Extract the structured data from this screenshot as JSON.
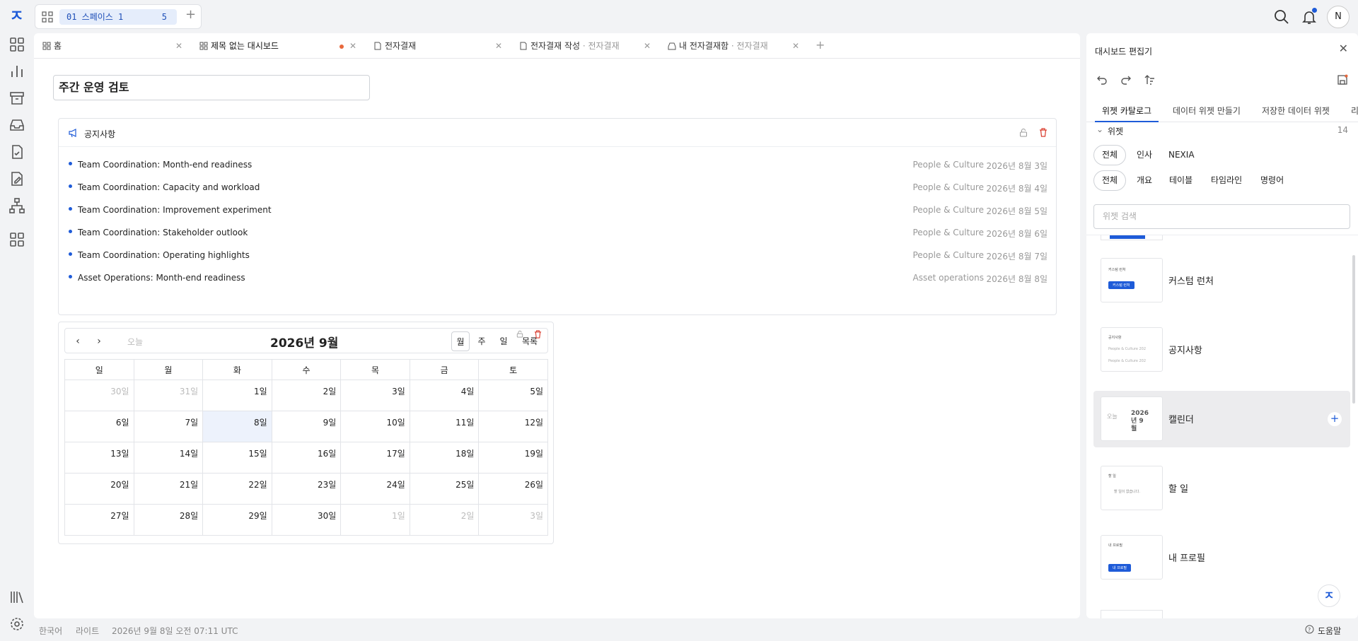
{
  "app": {
    "logo_glyph": "ㅈ",
    "space_label": "01 스페이스 1",
    "space_count": "5",
    "user_initial": "N"
  },
  "tabs": [
    {
      "label": "홈",
      "sub": ""
    },
    {
      "label": "제목 없는 대시보드",
      "sub": ""
    },
    {
      "label": "전자결재",
      "sub": ""
    },
    {
      "label": "전자결재 작성",
      "sub": "· 전자결재"
    },
    {
      "label": "내 전자결재함",
      "sub": "· 전자결재"
    }
  ],
  "dashboard": {
    "title": "주간 운영 검토"
  },
  "notice": {
    "title": "공지사항",
    "items": [
      {
        "text": "Team Coordination: Month-end readiness",
        "category": "People & Culture",
        "date": "2026년 8월 3일"
      },
      {
        "text": "Team Coordination: Capacity and workload",
        "category": "People & Culture",
        "date": "2026년 8월 4일"
      },
      {
        "text": "Team Coordination: Improvement experiment",
        "category": "People & Culture",
        "date": "2026년 8월 5일"
      },
      {
        "text": "Team Coordination: Stakeholder outlook",
        "category": "People & Culture",
        "date": "2026년 8월 6일"
      },
      {
        "text": "Team Coordination: Operating highlights",
        "category": "People & Culture",
        "date": "2026년 8월 7일"
      },
      {
        "text": "Asset Operations: Month-end readiness",
        "category": "Asset operations",
        "date": "2026년 8월 8일"
      }
    ]
  },
  "calendar": {
    "title": "2026년 9월",
    "today_label": "오늘",
    "views": [
      "월",
      "주",
      "일",
      "목록"
    ],
    "weekdays": [
      "일",
      "월",
      "화",
      "수",
      "목",
      "금",
      "토"
    ],
    "weeks": [
      [
        "30일",
        "31일",
        "1일",
        "2일",
        "3일",
        "4일",
        "5일"
      ],
      [
        "6일",
        "7일",
        "8일",
        "9일",
        "10일",
        "11일",
        "12일"
      ],
      [
        "13일",
        "14일",
        "15일",
        "16일",
        "17일",
        "18일",
        "19일"
      ],
      [
        "20일",
        "21일",
        "22일",
        "23일",
        "24일",
        "25일",
        "26일"
      ],
      [
        "27일",
        "28일",
        "29일",
        "30일",
        "1일",
        "2일",
        "3일"
      ]
    ]
  },
  "status": {
    "language": "한국어",
    "theme": "라이트",
    "datetime": "2026년 9월 8일 오전 07:11 UTC",
    "help": "도움말"
  },
  "editor": {
    "title": "대시보드 편집기",
    "tabs": [
      "위젯 카탈로그",
      "데이터 위젯 만들기",
      "저장한 데이터 위젯",
      "리"
    ],
    "section_label": "위젯",
    "section_count": "14",
    "filter1": [
      "전체",
      "인사",
      "NEXIA"
    ],
    "filter2": [
      "전체",
      "개요",
      "테이블",
      "타임라인",
      "명령어"
    ],
    "search_placeholder": "위젯 검색",
    "widgets": [
      {
        "name": "커스텀 런처",
        "thumb_title": "커스텀 런처",
        "thumb_btn": "커스텀 런처"
      },
      {
        "name": "공지사항",
        "thumb_title": "공지사항",
        "thumb_line": "People & Culture 202"
      },
      {
        "name": "캘린더",
        "thumb_title": "2026 년 9 월",
        "thumb_line": "오늘"
      },
      {
        "name": "할 일",
        "thumb_title": "할 일",
        "thumb_line": "할 일이 없습니다."
      },
      {
        "name": "내 프로필",
        "thumb_title": "내 프로필",
        "thumb_btn": "내 프로필"
      }
    ],
    "accent": "#1e5bd8"
  }
}
